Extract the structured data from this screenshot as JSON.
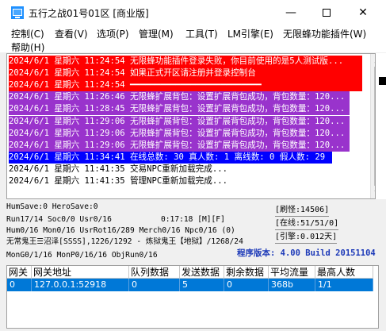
{
  "window": {
    "title": "五行之战01号01区 [商业版]",
    "minimize_glyph": "—",
    "close_glyph": "✕"
  },
  "menu": {
    "items": [
      "控制(C)",
      "查看(V)",
      "选项(P)",
      "管理(M)",
      "工具(T)",
      "LM引擎(E)",
      "无限蜂功能插件(W)",
      "帮助(H)"
    ]
  },
  "log": {
    "lines": [
      {
        "text": "2024/6/1 星期六 11:24:54 无限蜂功能插件登录失败，你目前使用的是5人测试版...",
        "style": "red"
      },
      {
        "text": "2024/6/1 星期六 11:24:54 如果正式开区请注册并登录控制台",
        "style": "red"
      },
      {
        "text": "2024/6/1 星期六 11:24:54 ━━━━━━━━━━━━━━━━━━━━━━━━━━",
        "style": "red"
      },
      {
        "text": "2024/6/1 星期六 11:26:46 无限蜂扩展背包：设置扩展背包成功，背包数量：120...",
        "style": "purple"
      },
      {
        "text": "2024/6/1 星期六 11:28:45 无限蜂扩展背包：设置扩展背包成功，背包数量：120...",
        "style": "purple"
      },
      {
        "text": "2024/6/1 星期六 11:29:06 无限蜂扩展背包：设置扩展背包成功，背包数量：120...",
        "style": "purple"
      },
      {
        "text": "2024/6/1 星期六 11:29:06 无限蜂扩展背包：设置扩展背包成功，背包数量：120...",
        "style": "purple"
      },
      {
        "text": "2024/6/1 星期六 11:29:06 无限蜂扩展背包：设置扩展背包成功，背包数量：120...",
        "style": "purple"
      },
      {
        "text": "2024/6/1 星期六 11:34:41 在线总数: 30 真人数: 1 离线数: 0 假人数: 29",
        "style": "blue"
      },
      {
        "text": "2024/6/1 星期六 11:41:35 交易NPC重新加载完成...",
        "style": "normal"
      },
      {
        "text": "2024/6/1 星期六 11:41:35 管理NPC重新加载完成...",
        "style": "normal"
      }
    ],
    "colors": {
      "red": "#ff0000",
      "purple": "#9933cc",
      "blue": "#0000ff",
      "text_on_color": "#ffffff",
      "text_normal": "#000000"
    }
  },
  "status": {
    "line1": "HumSave:0 HeroSave:0",
    "line2_left": "Run17/14 Soc0/0 Usr0/16",
    "line2_mid": "0:17:18 [M][F]",
    "line3": "Hum0/16 Mon0/16 UsrRot16/289 Merch0/16 Npc0/16 (0)",
    "line4": "无常鬼王☰沼泽[SSSS],1226/1292 - 炼狱鬼王【地狱】/1268/24",
    "line5": "MonG0/1/16 MonP0/16/16 ObjRun0/16",
    "refresh": "[刷怪:14506]",
    "online": "[在线:51/51/0]",
    "engine": "[引擎:0.012天]",
    "version": "程序版本: 4.00 Build 20151104"
  },
  "gateway_table": {
    "columns": [
      "网关",
      "网关地址",
      "队列数据",
      "发送数据",
      "剩余数据",
      "平均流量",
      "最高人数"
    ],
    "rows": [
      [
        "0",
        "127.0.0.1:52918",
        "0",
        "5",
        "0",
        "368b",
        "1/1"
      ]
    ]
  }
}
